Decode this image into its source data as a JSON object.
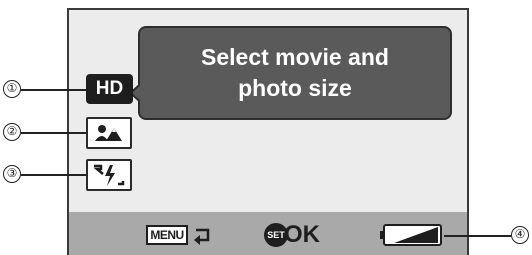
{
  "screen": {
    "tooltip": {
      "line1": "Select movie and",
      "line2": "photo size"
    },
    "icons": [
      {
        "name": "hd-icon",
        "label": "HD"
      },
      {
        "name": "scene-select-icon"
      },
      {
        "name": "flash-icon"
      }
    ],
    "bottom_bar": {
      "menu_label": "MENU",
      "set_label": "SET",
      "ok_label": "OK"
    },
    "battery": {
      "level": 0.6
    }
  },
  "callouts": [
    "①",
    "②",
    "③",
    "④"
  ],
  "colors": {
    "screen_bg": "#ececec",
    "tooltip_bg": "#5a5a5a",
    "bar_bg": "#a9a9a9",
    "icon_dark": "#1e1e1e"
  }
}
